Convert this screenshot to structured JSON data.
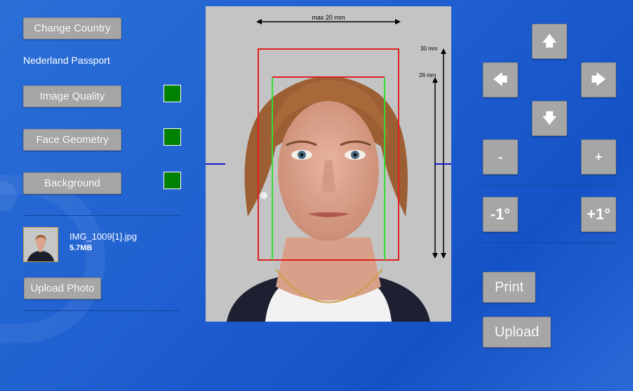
{
  "left_panel": {
    "change_country": "Change Country",
    "document_type": "Nederland Passport",
    "checks": [
      {
        "label": "Image Quality",
        "status": "pass",
        "color": "#008000"
      },
      {
        "label": "Face Geometry",
        "status": "pass",
        "color": "#008000"
      },
      {
        "label": "Background",
        "status": "pass",
        "color": "#008000"
      }
    ],
    "file": {
      "name": "IMG_1009[1].jpg",
      "size": "5.7MB"
    },
    "upload_photo": "Upload Photo"
  },
  "photo": {
    "width_label": "max 20 mm",
    "height_outer_label": "30 mm",
    "height_inner_label": "26 mm",
    "colors": {
      "face_box": "#e02020",
      "eye_lines": "#33dd33",
      "center_line": "#1a1ad0"
    }
  },
  "right_panel": {
    "move": {
      "up": "up-arrow-icon",
      "left": "left-arrow-icon",
      "right": "right-arrow-icon",
      "down": "down-arrow-icon"
    },
    "zoom_out": "-",
    "zoom_in": "+",
    "rotate_left": "-1°",
    "rotate_right": "+1°",
    "print": "Print",
    "upload": "Upload"
  }
}
